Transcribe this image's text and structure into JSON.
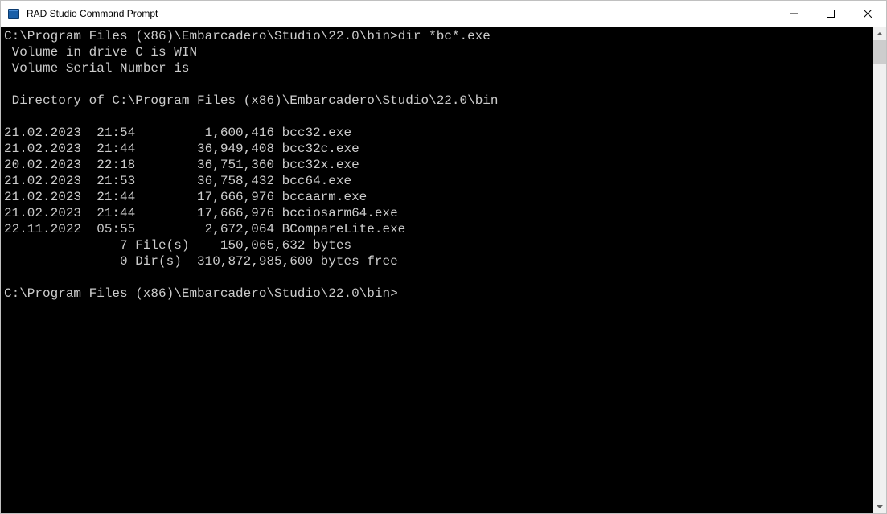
{
  "window": {
    "title": "RAD Studio Command Prompt"
  },
  "console": {
    "prompt1_path": "C:\\Program Files (x86)\\Embarcadero\\Studio\\22.0\\bin>",
    "command1": "dir *bc*.exe",
    "volume_line": " Volume in drive C is WIN",
    "serial_line": " Volume Serial Number is ",
    "directory_of": " Directory of C:\\Program Files (x86)\\Embarcadero\\Studio\\22.0\\bin",
    "rows": [
      {
        "date": "21.02.2023",
        "time": "21:54",
        "size": "1,600,416",
        "name": "bcc32.exe"
      },
      {
        "date": "21.02.2023",
        "time": "21:44",
        "size": "36,949,408",
        "name": "bcc32c.exe"
      },
      {
        "date": "20.02.2023",
        "time": "22:18",
        "size": "36,751,360",
        "name": "bcc32x.exe"
      },
      {
        "date": "21.02.2023",
        "time": "21:53",
        "size": "36,758,432",
        "name": "bcc64.exe"
      },
      {
        "date": "21.02.2023",
        "time": "21:44",
        "size": "17,666,976",
        "name": "bccaarm.exe"
      },
      {
        "date": "21.02.2023",
        "time": "21:44",
        "size": "17,666,976",
        "name": "bcciosarm64.exe"
      },
      {
        "date": "22.11.2022",
        "time": "05:55",
        "size": "2,672,064",
        "name": "BCompareLite.exe"
      }
    ],
    "summary_files": "               7 File(s)    150,065,632 bytes",
    "summary_dirs": "               0 Dir(s)  310,872,985,600 bytes free",
    "prompt2_path": "C:\\Program Files (x86)\\Embarcadero\\Studio\\22.0\\bin>"
  }
}
